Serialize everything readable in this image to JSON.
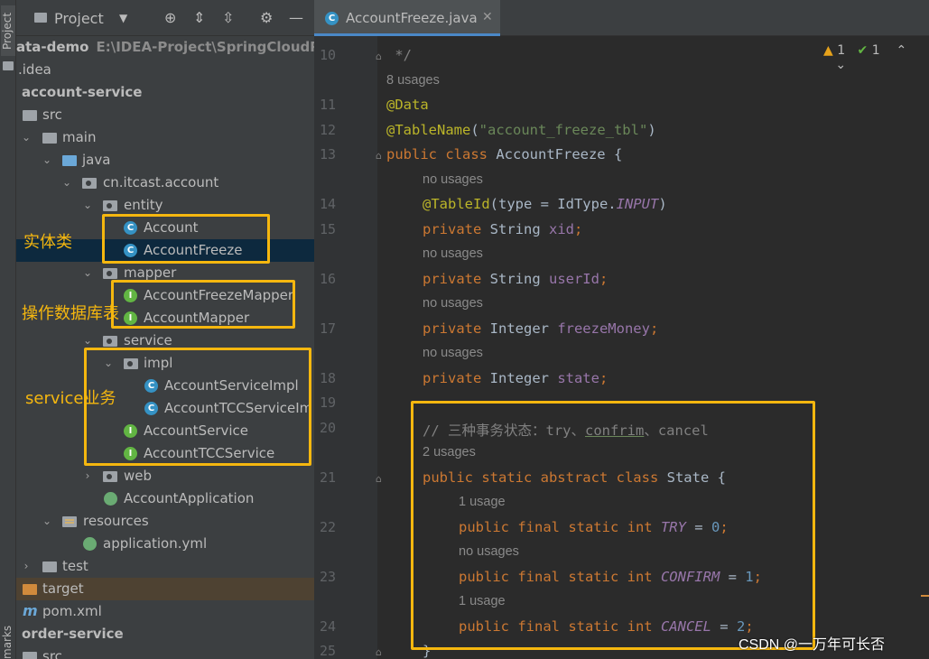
{
  "side_strip": {
    "top_label": "Project",
    "bottom_label": "marks"
  },
  "project_panel": {
    "title": "Project"
  },
  "tree": [
    {
      "label": "ata-demo",
      "path": "E:\\IDEA-Project\\SpringCloudProje",
      "bold": true
    },
    {
      "label": ".idea"
    },
    {
      "label": "account-service",
      "bold": true
    },
    {
      "label": "src"
    },
    {
      "label": "main"
    },
    {
      "label": "java"
    },
    {
      "label": "cn.itcast.account"
    },
    {
      "label": "entity"
    },
    {
      "label": "Account"
    },
    {
      "label": "AccountFreeze"
    },
    {
      "label": "mapper"
    },
    {
      "label": "AccountFreezeMapper"
    },
    {
      "label": "AccountMapper"
    },
    {
      "label": "service"
    },
    {
      "label": "impl"
    },
    {
      "label": "AccountServiceImpl"
    },
    {
      "label": "AccountTCCServiceIm"
    },
    {
      "label": "AccountService"
    },
    {
      "label": "AccountTCCService"
    },
    {
      "label": "web"
    },
    {
      "label": "AccountApplication"
    },
    {
      "label": "resources"
    },
    {
      "label": "application.yml"
    },
    {
      "label": "test"
    },
    {
      "label": "target"
    },
    {
      "label": "pom.xml"
    },
    {
      "label": "order-service",
      "bold": true
    },
    {
      "label": "src"
    }
  ],
  "annotations": {
    "entity": "实体类",
    "mapper": "操作数据库表",
    "service": "service业务"
  },
  "editor": {
    "tab_name": "AccountFreeze.java",
    "inspections": {
      "warnings": "1",
      "ok": "1"
    },
    "line_numbers": [
      "10",
      "11",
      "12",
      "13",
      "14",
      "15",
      "16",
      "17",
      "18",
      "19",
      "20",
      "21",
      "22",
      "23",
      "24",
      "25"
    ],
    "hints": {
      "h8": "8 usages",
      "h_no1": "no usages",
      "h_no2": "no usages",
      "h_no3": "no usages",
      "h_no4": "no usages",
      "h2": "2 usages",
      "h1a": "1 usage",
      "h_no5": "no usages",
      "h1b": "1 usage"
    },
    "code": {
      "l10": " */",
      "l11": "@Data",
      "l12_ann": "@TableName",
      "l12_str": "\"account_freeze_tbl\"",
      "l13_kw": "public class ",
      "l13_rest": "AccountFreeze {",
      "l14_ann": "@TableId",
      "l14_mid": "(type = IdType.",
      "l14_it": "INPUT",
      "l15_kw": "private ",
      "l15_t": "String ",
      "l15_f": "xid",
      "l16_f": "userId",
      "l17_t": "Integer ",
      "l17_f": "freezeMoney",
      "l18_f": "state",
      "l20_a": "// 三种事务状态：try、",
      "l20_b": "confrim",
      "l20_c": "、cancel",
      "l21_kw": "public static abstract class ",
      "l21_rest": "State {",
      "final_kw": "public final static int ",
      "l22_n": "TRY",
      "l22_v": "0",
      "l23_n": "CONFIRM",
      "l23_v": "1",
      "l24_n": "CANCEL",
      "l24_v": "2",
      "l25": "}"
    },
    "watermark": "CSDN @一万年可长否"
  },
  "colors": {
    "highlight": "#f5b70f",
    "keyword": "#cc7832",
    "annotation": "#bbb529"
  }
}
